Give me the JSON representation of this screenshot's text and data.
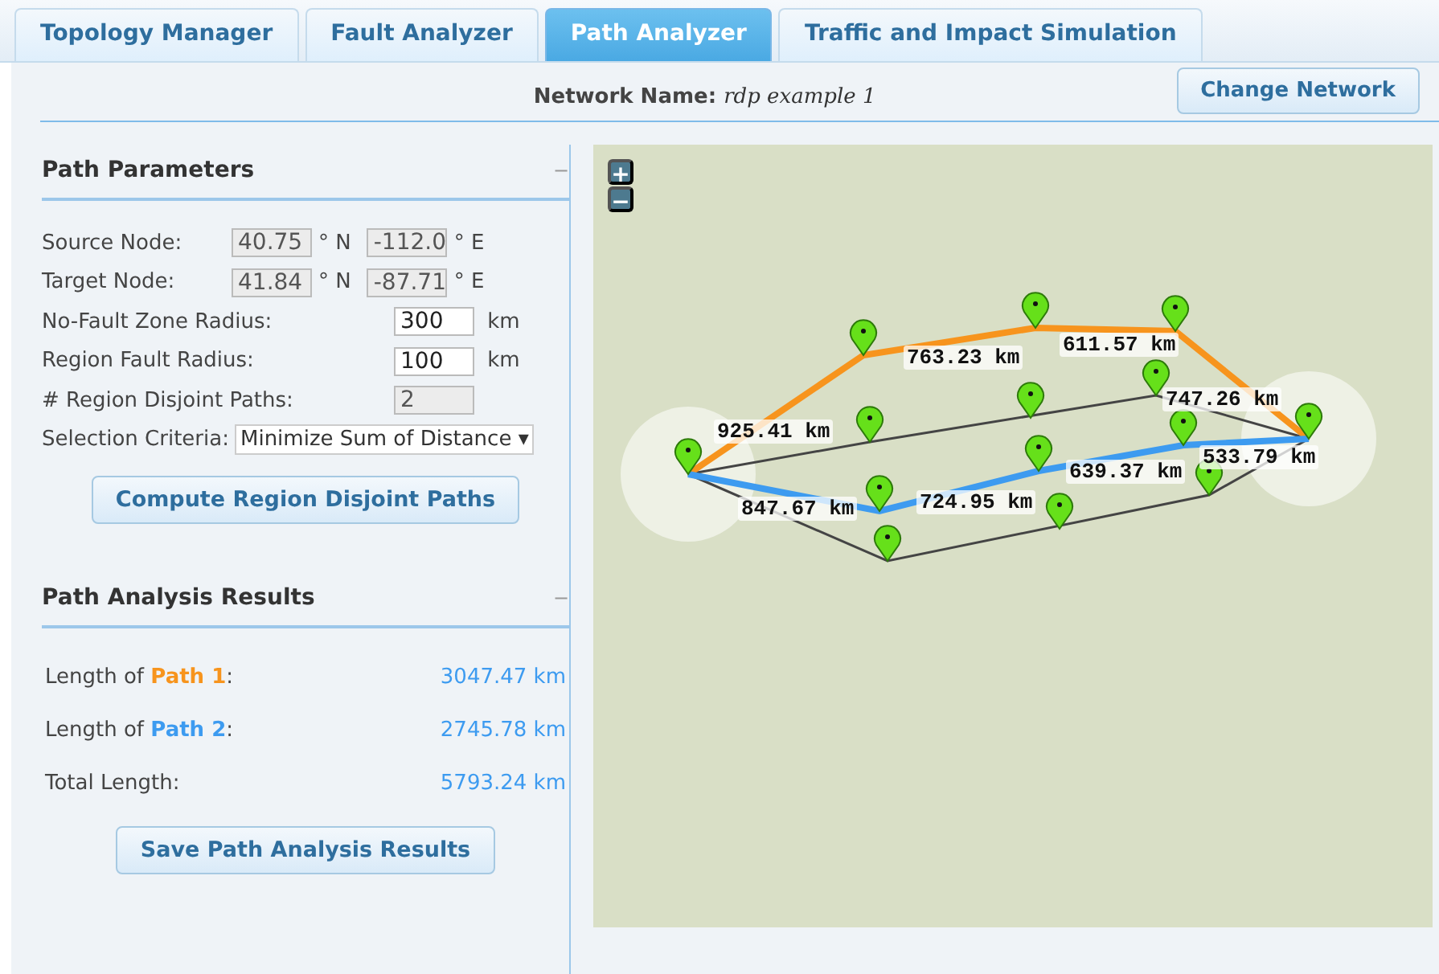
{
  "tabs": [
    {
      "label": "Topology Manager",
      "selected": false
    },
    {
      "label": "Fault Analyzer",
      "selected": false
    },
    {
      "label": "Path Analyzer",
      "selected": true
    },
    {
      "label": "Traffic and Impact Simulation",
      "selected": false
    }
  ],
  "network": {
    "label": "Network Name:",
    "value": "rdp example 1",
    "button": "Change Network"
  },
  "path_parameters": {
    "title": "Path Parameters",
    "collapse": "−",
    "rows": [
      {
        "kind": "coords",
        "label": "Source Node:",
        "lat": "40.75",
        "lat_unit": "° N",
        "lon": "-112.0",
        "lon_unit": "° E",
        "disabled": true
      },
      {
        "kind": "coords",
        "label": "Target Node:",
        "lat": "41.84",
        "lat_unit": "° N",
        "lon": "-87.71",
        "lon_unit": "° E",
        "disabled": true
      },
      {
        "kind": "input",
        "label": "No-Fault Zone Radius:",
        "value": "300",
        "unit": "km",
        "disabled": false
      },
      {
        "kind": "input",
        "label": "Region Fault Radius:",
        "value": "100",
        "unit": "km",
        "disabled": false
      },
      {
        "kind": "input",
        "label": "# Region Disjoint Paths:",
        "value": "2",
        "disabled": true
      },
      {
        "kind": "select",
        "label": "Selection Criteria:",
        "value": "Minimize Sum of Distance",
        "caret": "▾"
      }
    ],
    "button": "Compute Region Disjoint Paths"
  },
  "results": {
    "title": "Path Analysis Results",
    "collapse": "−",
    "rows": [
      {
        "label": "Length of **Path 1**:",
        "color": "#f7941d",
        "value": "3047.47 km"
      },
      {
        "label": "Length of **Path 2**:",
        "color": "#3d9bf0",
        "value": "2745.78 km"
      },
      {
        "label": "Total Length:",
        "value": "5793.24 km"
      }
    ],
    "button": "Save Path Analysis Results"
  },
  "map": {
    "zoom_in": "+",
    "zoom_out": "−",
    "paths": [
      {
        "color": "#f7941d",
        "segments": [
          "925.41 km",
          "763.23 km",
          "611.57 km",
          "747.26 km"
        ]
      },
      {
        "color": "#3d9bf0",
        "segments": [
          "847.67 km",
          "724.95 km",
          "639.37 km",
          "533.79 km"
        ]
      }
    ]
  }
}
